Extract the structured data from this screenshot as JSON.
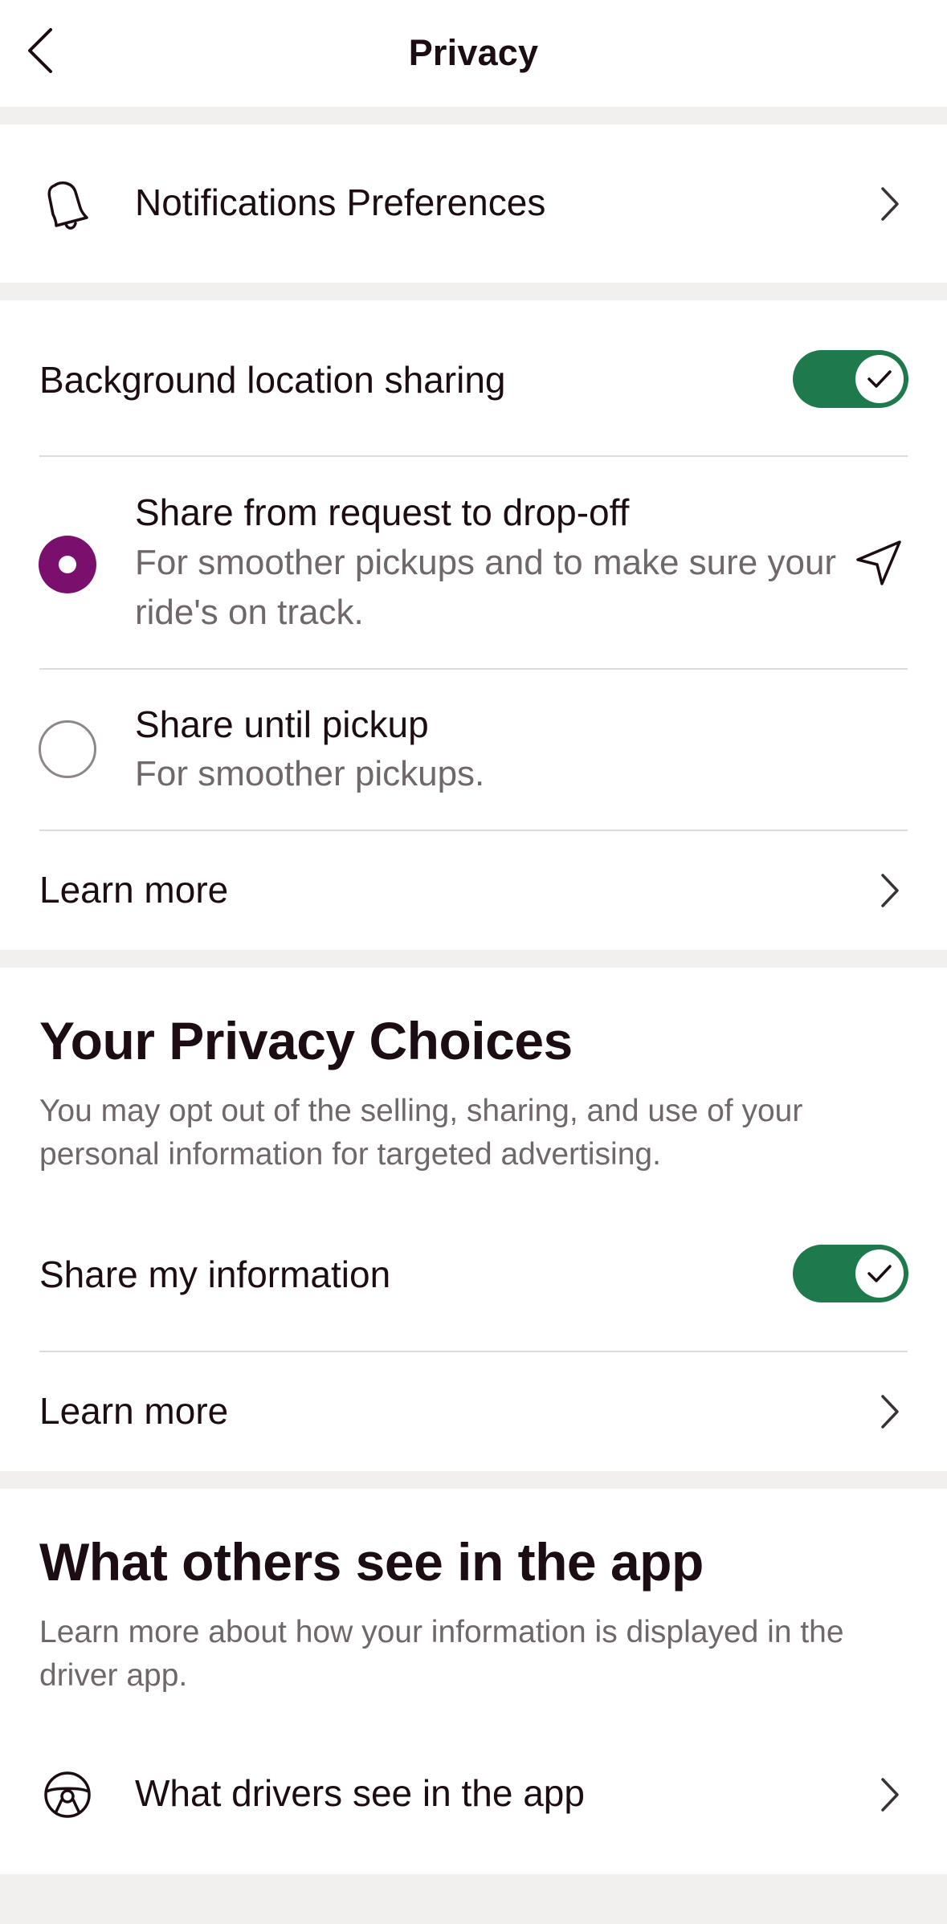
{
  "header": {
    "title": "Privacy",
    "back_icon": "chevron-left-icon"
  },
  "notifications": {
    "label": "Notifications Preferences",
    "icon": "bell-icon"
  },
  "location": {
    "label": "Background location sharing",
    "toggle_on": true,
    "options": [
      {
        "title": "Share from request to drop-off",
        "subtitle": "For smoother pickups and to make sure your ride's on track.",
        "selected": true,
        "icon": "navigation-arrow-icon"
      },
      {
        "title": "Share until pickup",
        "subtitle": "For smoother pickups.",
        "selected": false
      }
    ],
    "learn_more": "Learn more"
  },
  "privacy_choices": {
    "heading": "Your Privacy Choices",
    "description": "You may opt out of the selling, sharing, and use of your personal information for targeted advertising.",
    "share_label": "Share my information",
    "toggle_on": true,
    "learn_more": "Learn more"
  },
  "others_see": {
    "heading": "What others see in the app",
    "description": "Learn more about how your information is displayed in the driver app.",
    "drivers_label": "What drivers see in the app",
    "icon": "steering-wheel-icon"
  },
  "colors": {
    "toggle_green": "#1e7a4c",
    "radio_purple": "#7b0f6e",
    "separator": "#f1f0ee",
    "text_primary": "#1c0d14",
    "text_secondary": "#6f676b"
  }
}
